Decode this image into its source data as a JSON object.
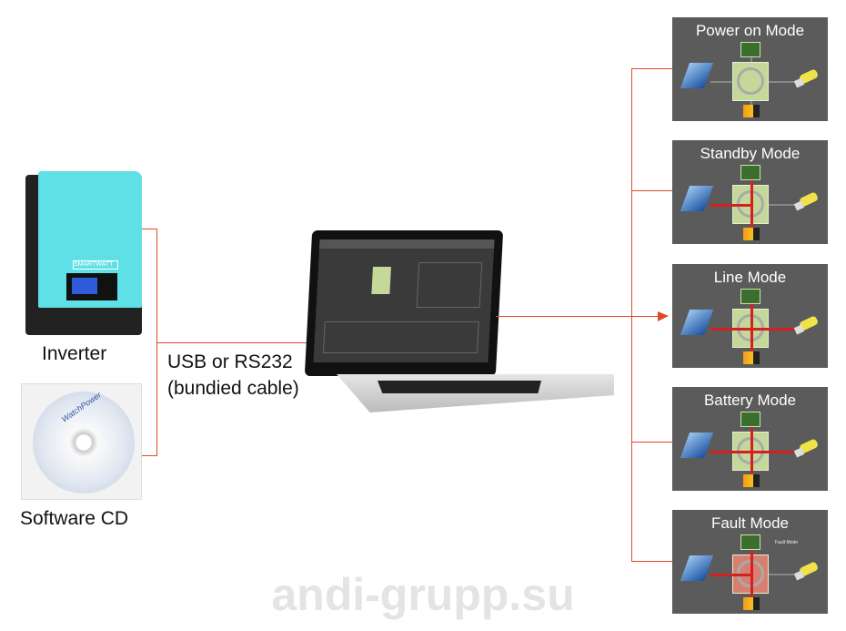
{
  "left": {
    "inverter_label": "Inverter",
    "inverter_brand": "SMARTWATT",
    "cd_label": "Software CD",
    "cd_brand": "WatchPower"
  },
  "connection_label": [
    "USB or RS232",
    "(bundied cable)"
  ],
  "modes": [
    {
      "title": "Power on Mode",
      "flow": "none"
    },
    {
      "title": "Standby Mode",
      "flow": "standby"
    },
    {
      "title": "Line Mode",
      "flow": "line"
    },
    {
      "title": "Battery Mode",
      "flow": "battery"
    },
    {
      "title": "Fault Mode",
      "flow": "fault",
      "note": "Fault Mode"
    }
  ],
  "watermark": "andi-grupp.su",
  "colors": {
    "connector": "#e0492a",
    "mode_bg": "#5b5b5b",
    "inverter_body": "#5fe0e6"
  }
}
